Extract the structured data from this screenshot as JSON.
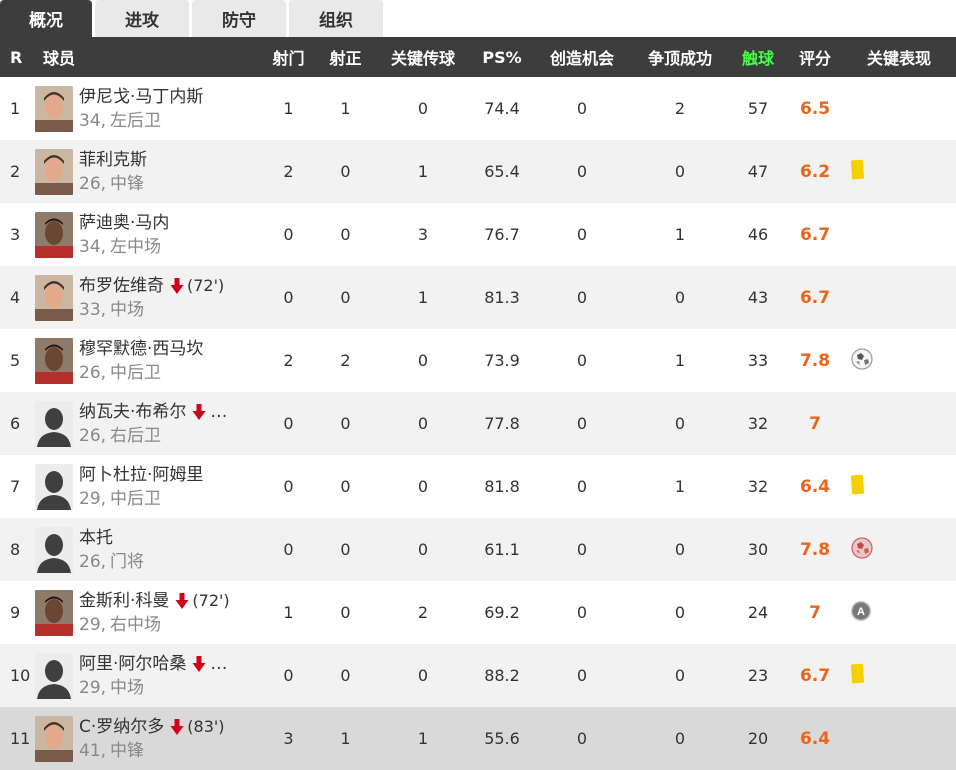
{
  "tabs": [
    {
      "label": "概况",
      "active": true
    },
    {
      "label": "进攻",
      "active": false
    },
    {
      "label": "防守",
      "active": false
    },
    {
      "label": "组织",
      "active": false
    }
  ],
  "columns": {
    "rank": "R",
    "player": "球员",
    "shots": "射门",
    "on_target": "射正",
    "key_passes": "关键传球",
    "ps": "PS%",
    "chances": "创造机会",
    "aerials": "争顶成功",
    "touches": "触球",
    "rating": "评分",
    "key_events": "关键表现"
  },
  "colors": {
    "header_bg": "#3d3d3d",
    "touch_header": "#44ff44",
    "rating": "#e8661a",
    "sub_arrow": "#d0021b",
    "yellow_card": "#f5d000"
  },
  "players": [
    {
      "rank": "1",
      "name": "伊尼戈·马丁内斯",
      "age": "34",
      "position": "左后卫",
      "sub_minute": "",
      "truncated": false,
      "shots": "1",
      "on_target": "1",
      "key_passes": "0",
      "ps": "74.4",
      "chances": "0",
      "aerials": "2",
      "touches": "57",
      "rating": "6.5",
      "key_event_icon": "",
      "photo": "skin"
    },
    {
      "rank": "2",
      "name": "菲利克斯",
      "age": "26",
      "position": "中锋",
      "sub_minute": "",
      "truncated": false,
      "shots": "2",
      "on_target": "0",
      "key_passes": "1",
      "ps": "65.4",
      "chances": "0",
      "aerials": "0",
      "touches": "47",
      "rating": "6.2",
      "key_event_icon": "yellow-card-icon",
      "photo": "skin"
    },
    {
      "rank": "3",
      "name": "萨迪奥·马内",
      "age": "34",
      "position": "左中场",
      "sub_minute": "",
      "truncated": false,
      "shots": "0",
      "on_target": "0",
      "key_passes": "3",
      "ps": "76.7",
      "chances": "0",
      "aerials": "1",
      "touches": "46",
      "rating": "6.7",
      "key_event_icon": "",
      "photo": "dark"
    },
    {
      "rank": "4",
      "name": "布罗佐维奇",
      "age": "33",
      "position": "中场",
      "sub_minute": "(72')",
      "truncated": false,
      "shots": "0",
      "on_target": "0",
      "key_passes": "1",
      "ps": "81.3",
      "chances": "0",
      "aerials": "0",
      "touches": "43",
      "rating": "6.7",
      "key_event_icon": "",
      "photo": "skin"
    },
    {
      "rank": "5",
      "name": "穆罕默德·西马坎",
      "age": "26",
      "position": "中后卫",
      "sub_minute": "",
      "truncated": false,
      "shots": "2",
      "on_target": "2",
      "key_passes": "0",
      "ps": "73.9",
      "chances": "0",
      "aerials": "1",
      "touches": "33",
      "rating": "7.8",
      "key_event_icon": "goal-ball-icon",
      "photo": "dark"
    },
    {
      "rank": "6",
      "name": "纳瓦夫·布希尔",
      "age": "26",
      "position": "右后卫",
      "sub_minute": "",
      "truncated": true,
      "shots": "0",
      "on_target": "0",
      "key_passes": "0",
      "ps": "77.8",
      "chances": "0",
      "aerials": "0",
      "touches": "32",
      "rating": "7",
      "key_event_icon": "",
      "photo": "silhouette"
    },
    {
      "rank": "7",
      "name": "阿卜杜拉·阿姆里",
      "age": "29",
      "position": "中后卫",
      "sub_minute": "",
      "truncated": false,
      "shots": "0",
      "on_target": "0",
      "key_passes": "0",
      "ps": "81.8",
      "chances": "0",
      "aerials": "1",
      "touches": "32",
      "rating": "6.4",
      "key_event_icon": "yellow-card-icon",
      "photo": "silhouette"
    },
    {
      "rank": "8",
      "name": "本托",
      "age": "26",
      "position": "门将",
      "sub_minute": "",
      "truncated": false,
      "shots": "0",
      "on_target": "0",
      "key_passes": "0",
      "ps": "61.1",
      "chances": "0",
      "aerials": "0",
      "touches": "30",
      "rating": "7.8",
      "key_event_icon": "save-ball-icon",
      "photo": "silhouette"
    },
    {
      "rank": "9",
      "name": "金斯利·科曼",
      "age": "29",
      "position": "右中场",
      "sub_minute": "(72')",
      "truncated": false,
      "shots": "1",
      "on_target": "0",
      "key_passes": "2",
      "ps": "69.2",
      "chances": "0",
      "aerials": "0",
      "touches": "24",
      "rating": "7",
      "key_event_icon": "assist-icon",
      "photo": "dark"
    },
    {
      "rank": "10",
      "name": "阿里·阿尔哈桑",
      "age": "29",
      "position": "中场",
      "sub_minute": "",
      "truncated": true,
      "shots": "0",
      "on_target": "0",
      "key_passes": "0",
      "ps": "88.2",
      "chances": "0",
      "aerials": "0",
      "touches": "23",
      "rating": "6.7",
      "key_event_icon": "yellow-card-icon",
      "photo": "silhouette"
    },
    {
      "rank": "11",
      "name": "C·罗纳尔多",
      "age": "41",
      "position": "中锋",
      "sub_minute": "(83')",
      "truncated": false,
      "shots": "3",
      "on_target": "1",
      "key_passes": "1",
      "ps": "55.6",
      "chances": "0",
      "aerials": "0",
      "touches": "20",
      "rating": "6.4",
      "key_event_icon": "",
      "photo": "skin"
    }
  ]
}
